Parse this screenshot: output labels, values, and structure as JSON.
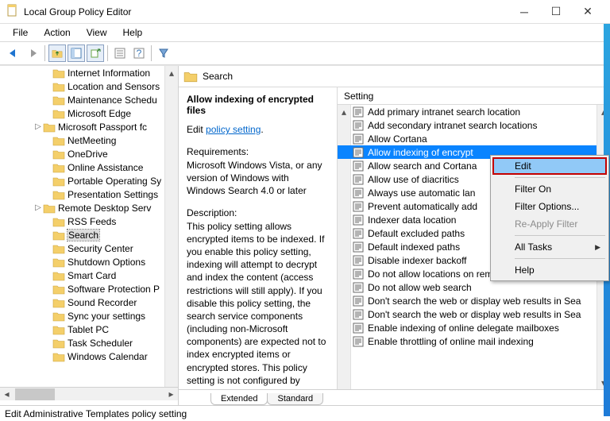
{
  "titlebar": {
    "title": "Local Group Policy Editor"
  },
  "menubar": [
    "File",
    "Action",
    "View",
    "Help"
  ],
  "tree": {
    "items": [
      {
        "ind": 54,
        "exp": false,
        "label": "Internet Information "
      },
      {
        "ind": 54,
        "exp": false,
        "label": "Location and Sensors"
      },
      {
        "ind": 54,
        "exp": false,
        "label": "Maintenance Schedu"
      },
      {
        "ind": 54,
        "exp": false,
        "label": "Microsoft Edge"
      },
      {
        "ind": 42,
        "exp": true,
        "label": "Microsoft Passport fc"
      },
      {
        "ind": 54,
        "exp": false,
        "label": "NetMeeting"
      },
      {
        "ind": 54,
        "exp": false,
        "label": "OneDrive"
      },
      {
        "ind": 54,
        "exp": false,
        "label": "Online Assistance"
      },
      {
        "ind": 54,
        "exp": false,
        "label": "Portable Operating Sy"
      },
      {
        "ind": 54,
        "exp": false,
        "label": "Presentation Settings"
      },
      {
        "ind": 42,
        "exp": true,
        "label": "Remote Desktop Serv"
      },
      {
        "ind": 54,
        "exp": false,
        "label": "RSS Feeds"
      },
      {
        "ind": 54,
        "exp": false,
        "label": "Search",
        "selected": true
      },
      {
        "ind": 54,
        "exp": false,
        "label": "Security Center"
      },
      {
        "ind": 54,
        "exp": false,
        "label": "Shutdown Options"
      },
      {
        "ind": 54,
        "exp": false,
        "label": "Smart Card"
      },
      {
        "ind": 54,
        "exp": false,
        "label": "Software Protection P"
      },
      {
        "ind": 54,
        "exp": false,
        "label": "Sound Recorder"
      },
      {
        "ind": 54,
        "exp": false,
        "label": "Sync your settings"
      },
      {
        "ind": 54,
        "exp": false,
        "label": "Tablet PC"
      },
      {
        "ind": 54,
        "exp": false,
        "label": "Task Scheduler"
      },
      {
        "ind": 54,
        "exp": false,
        "label": "Windows Calendar"
      }
    ]
  },
  "detail": {
    "header": "Search",
    "desc": {
      "title": "Allow indexing of encrypted files",
      "edit_prefix": "Edit ",
      "edit_link": "policy setting",
      "req_label": "Requirements:",
      "req_text": "Microsoft Windows Vista, or any version of Windows with Windows Search 4.0 or later",
      "desc_label": "Description:",
      "desc_text": "This policy setting allows encrypted items to be indexed. If you enable this policy setting, indexing  will attempt to decrypt and index the content (access restrictions will still apply). If you disable this policy setting, the search service components (including non-Microsoft components) are expected not to index encrypted items or encrypted stores. This policy setting is not configured by default. If you do not configure"
    },
    "list_header": "Setting",
    "settings": [
      "Add primary intranet search location",
      "Add secondary intranet search locations",
      "Allow Cortana",
      "Allow indexing of encrypt",
      "Allow search and Cortana",
      "Allow use of diacritics",
      "Always use automatic lan",
      "Prevent automatically add",
      "Indexer data location",
      "Default excluded paths",
      "Default indexed paths",
      "Disable indexer backoff",
      "Do not allow locations on removable drives to be",
      "Do not allow web search",
      "Don't search the web or display web results in Sea",
      "Don't search the web or display web results in Sea",
      "Enable indexing of online delegate mailboxes",
      "Enable throttling of online mail indexing"
    ],
    "selected_index": 3
  },
  "tabs": {
    "extended": "Extended",
    "standard": "Standard"
  },
  "statusbar": "Edit Administrative Templates policy setting",
  "context_menu": {
    "items": [
      {
        "label": "Edit",
        "hl": true
      },
      {
        "sep": true
      },
      {
        "label": "Filter On"
      },
      {
        "label": "Filter Options..."
      },
      {
        "label": "Re-Apply Filter",
        "dis": true
      },
      {
        "sep": true
      },
      {
        "label": "All Tasks",
        "sub": true
      },
      {
        "sep": true
      },
      {
        "label": "Help"
      }
    ]
  }
}
